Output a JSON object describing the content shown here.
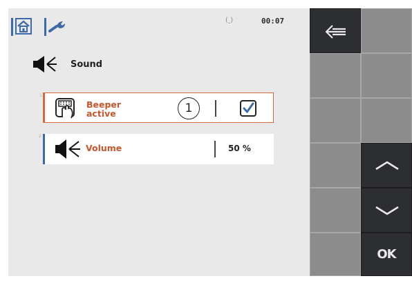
{
  "status": {
    "signal_glyph": "(ꞈ)",
    "time": "00:07"
  },
  "nav": {
    "home_icon": "home-icon",
    "settings_icon": "wrench-icon"
  },
  "section": {
    "icon": "speaker-icon",
    "title": "Sound"
  },
  "params": [
    {
      "index": "1",
      "icon": "beeper-icon",
      "label": "Beeper active",
      "value_type": "checkbox",
      "checked": true
    },
    {
      "index": "2",
      "icon": "speaker-icon",
      "label": "Volume",
      "value": "50 %"
    }
  ],
  "callout": {
    "label": "1"
  },
  "softkeys": {
    "back_icon": "back-arrow-icon",
    "up_icon": "chevron-up-icon",
    "down_icon": "chevron-down-icon",
    "ok_label": "OK"
  },
  "colors": {
    "accent_blue": "#3c6aa8",
    "accent_orange": "#d4693a",
    "label_orange": "#c8562d",
    "softkey_grey": "#8c8c8c",
    "softkey_dark": "#2d2e32",
    "panel_bg": "#e9e9e9"
  }
}
